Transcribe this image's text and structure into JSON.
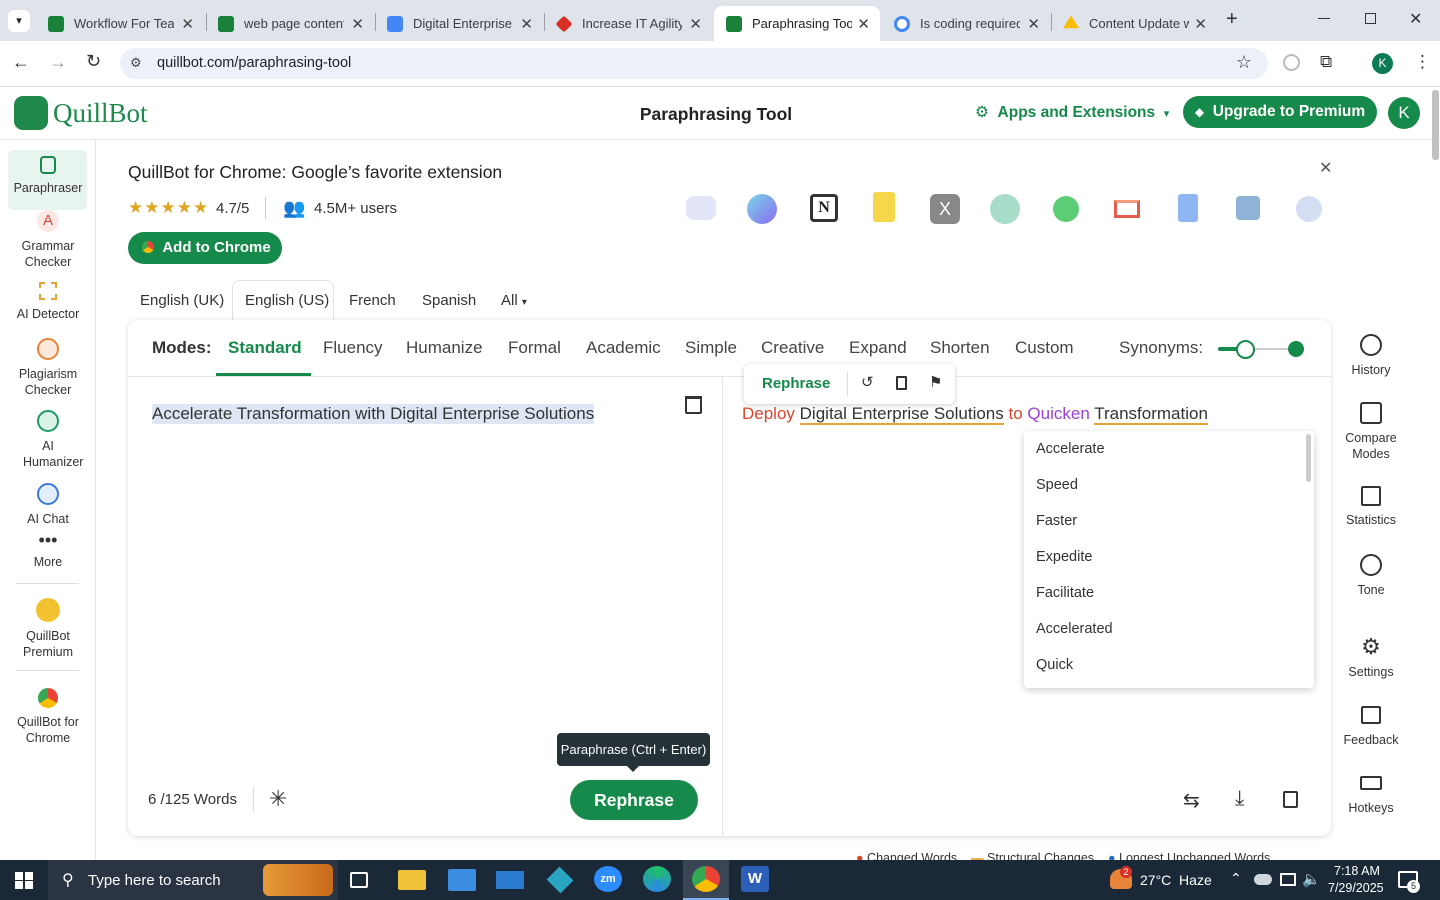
{
  "browser": {
    "tabs": [
      {
        "title": "Workflow For Tea",
        "color": "#188038"
      },
      {
        "title": "web page content",
        "color": "#188038"
      },
      {
        "title": "Digital Enterprise",
        "color": "#4285f4"
      },
      {
        "title": "Increase IT Agility",
        "color": "#d93025"
      },
      {
        "title": "Paraphrasing Tool",
        "color": "#188038"
      },
      {
        "title": "Is coding required",
        "color": "#4285f4"
      },
      {
        "title": "Content Update w",
        "color": "#fbbc04"
      }
    ],
    "url": "quillbot.com/paraphrasing-tool",
    "profile_initial": "K"
  },
  "header": {
    "logo": "QuillBot",
    "title": "Paraphrasing Tool",
    "apps": "Apps and Extensions",
    "upgrade": "Upgrade to Premium",
    "avatar": "K"
  },
  "sidebar": [
    {
      "label": "Paraphraser"
    },
    {
      "label": "Grammar Checker"
    },
    {
      "label": "AI Detector"
    },
    {
      "label": "Plagiarism Checker"
    },
    {
      "label": "AI Humanizer"
    },
    {
      "label": "AI Chat"
    },
    {
      "label": "More"
    },
    {
      "label": "QuillBot Premium"
    },
    {
      "label": "QuillBot for Chrome"
    }
  ],
  "promo": {
    "title": "QuillBot for Chrome: Google’s favorite extension",
    "rating": "4.7/5",
    "users": "4.5M+ users",
    "cta": "Add to Chrome"
  },
  "languages": [
    "English (UK)",
    "English (US)",
    "French",
    "Spanish",
    "All"
  ],
  "modes": {
    "label": "Modes:",
    "items": [
      "Standard",
      "Fluency",
      "Humanize",
      "Formal",
      "Academic",
      "Simple",
      "Creative",
      "Expand",
      "Shorten",
      "Custom"
    ],
    "synonyms": "Synonyms:"
  },
  "input": {
    "text": "Accelerate Transformation with Digital Enterprise Solutions",
    "wordcount": "6 /125 Words",
    "rephrase": "Rephrase",
    "tooltip": "Paraphrase (Ctrl + Enter)"
  },
  "output": {
    "toolbar_rephrase": "Rephrase",
    "w1": "Deploy",
    "w2": "Digital Enterprise Solutions",
    "w3": "to",
    "w4": "Quicken",
    "w5": "Transformation"
  },
  "suggestions": [
    "Accelerate",
    "Speed",
    "Faster",
    "Expedite",
    "Facilitate",
    "Accelerated",
    "Quick"
  ],
  "rightbar": [
    {
      "label": "History"
    },
    {
      "label": "Compare Modes"
    },
    {
      "label": "Statistics"
    },
    {
      "label": "Tone"
    },
    {
      "label": "Settings"
    },
    {
      "label": "Feedback"
    },
    {
      "label": "Hotkeys"
    }
  ],
  "legend": [
    "Changed Words",
    "Structural Changes",
    "Longest Unchanged Words"
  ],
  "taskbar": {
    "search": "Type here to search",
    "weather": "27°C  Haze",
    "time": "7:18 AM",
    "date": "7/29/2025",
    "notif": "5",
    "weather_badge": "2"
  }
}
